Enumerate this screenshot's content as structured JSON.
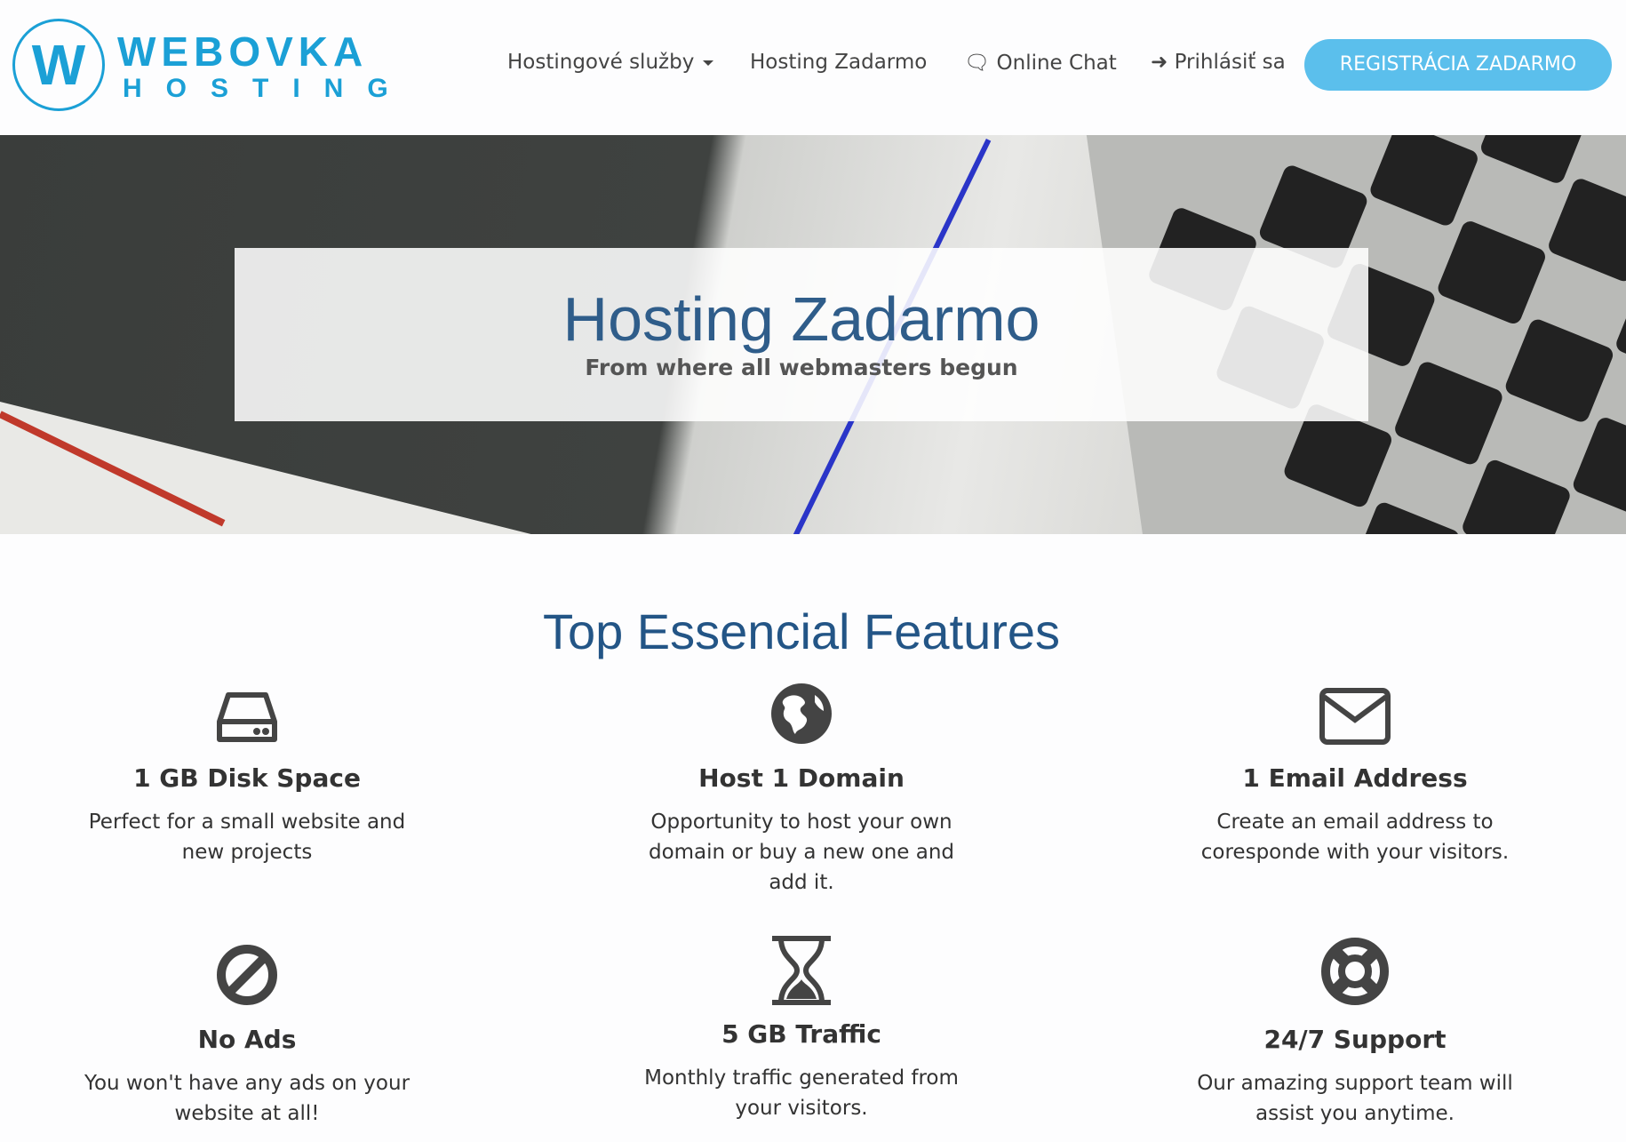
{
  "header": {
    "logo": {
      "mark": "W",
      "line1": "WEBOVKA",
      "line2": "HOSTING"
    },
    "nav": [
      {
        "label": "Hostingové služby",
        "icon": "caret-down-icon"
      },
      {
        "label": "Hosting Zadarmo"
      },
      {
        "label": "Online Chat",
        "icon": "comments-icon"
      },
      {
        "label": "Prihlásiť sa",
        "icon": "sign-in-icon"
      }
    ],
    "cta": "REGISTRÁCIA ZADARMO",
    "accent": "#5bbfec",
    "brand": "#1ba0d6"
  },
  "hero": {
    "title": "Hosting Zadarmo",
    "subtitle": "From where all webmasters begun"
  },
  "features": {
    "title": "Top Essencial Features",
    "items": [
      {
        "icon": "hard-drive-icon",
        "title": "1 GB Disk Space",
        "desc": "Perfect for a small website and new projects"
      },
      {
        "icon": "globe-icon",
        "title": "Host 1 Domain",
        "desc": "Opportunity to host your own domain or buy a new one and add it."
      },
      {
        "icon": "envelope-icon",
        "title": "1 Email Address",
        "desc": "Create an email address to coresponde with your visitors."
      },
      {
        "icon": "ban-icon",
        "title": "No Ads",
        "desc": "You won't have any ads on your website at all!"
      },
      {
        "icon": "hourglass-icon",
        "title": "5 GB Traffic",
        "desc": "Monthly traffic generated from your visitors."
      },
      {
        "icon": "life-ring-icon",
        "title": "24/7 Support",
        "desc": "Our amazing support team will assist you anytime."
      }
    ]
  }
}
